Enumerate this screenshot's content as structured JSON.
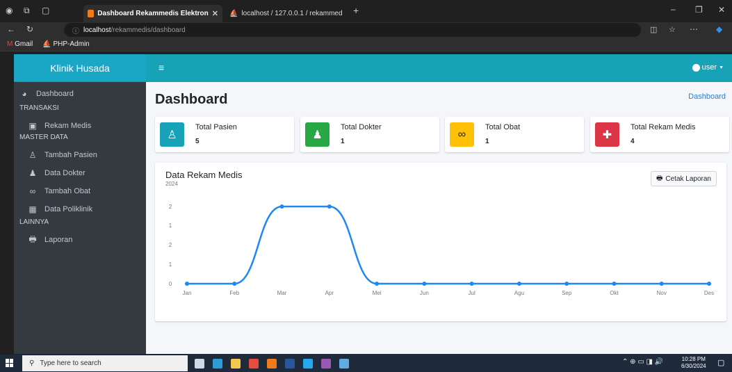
{
  "browser": {
    "tabs": [
      {
        "title": "Dashboard Rekammedis Elektron"
      },
      {
        "title": "localhost / 127.0.0.1 / rekammed"
      }
    ],
    "url_host": "localhost",
    "url_path": "/rekammedis/dashboard",
    "bookmarks": [
      "Gmail",
      "PHP-Admin"
    ]
  },
  "app": {
    "brand": "Klinik Husada",
    "user_label": "user"
  },
  "sidebar": {
    "items": [
      {
        "type": "item",
        "label": "Dashboard",
        "icon": "tachometer-icon"
      },
      {
        "type": "header",
        "label": "TRANSAKSI"
      },
      {
        "type": "item",
        "label": "Rekam Medis",
        "icon": "book-medical-icon"
      },
      {
        "type": "header",
        "label": "MASTER DATA"
      },
      {
        "type": "item",
        "label": "Tambah Pasien",
        "icon": "user-injured-icon"
      },
      {
        "type": "item",
        "label": "Data Dokter",
        "icon": "user-md-icon"
      },
      {
        "type": "item",
        "label": "Tambah Obat",
        "icon": "pills-icon"
      },
      {
        "type": "item",
        "label": "Data Poliklinik",
        "icon": "clinic-icon"
      },
      {
        "type": "header",
        "label": "LAINNYA"
      },
      {
        "type": "item",
        "label": "Laporan",
        "icon": "print-icon"
      }
    ]
  },
  "page": {
    "title": "Dashboard",
    "breadcrumb": "Dashboard"
  },
  "stats": [
    {
      "label": "Total Pasien",
      "value": "5",
      "color": "#17a2b8",
      "icon": "user-injured-icon"
    },
    {
      "label": "Total Dokter",
      "value": "1",
      "color": "#28a745",
      "icon": "user-md-icon"
    },
    {
      "label": "Total Obat",
      "value": "1",
      "color": "#ffc107",
      "icon": "pills-icon"
    },
    {
      "label": "Total Rekam Medis",
      "value": "4",
      "color": "#dc3545",
      "icon": "notes-medical-icon"
    }
  ],
  "chart_card": {
    "title": "Data Rekam Medis",
    "subtitle": "2024",
    "button_label": "Cetak Laporan"
  },
  "chart_data": {
    "type": "line",
    "categories": [
      "Jan",
      "Feb",
      "Mar",
      "Apr",
      "Mei",
      "Jun",
      "Jul",
      "Agu",
      "Sep",
      "Okt",
      "Nov",
      "Des"
    ],
    "values": [
      0,
      0,
      2,
      2,
      0,
      0,
      0,
      0,
      0,
      0,
      0,
      0
    ],
    "ylim": [
      0,
      2
    ],
    "yticks": [
      "0",
      "1",
      "2",
      "1",
      "2"
    ],
    "line_color": "#1e88f0",
    "grid": false
  },
  "taskbar": {
    "search_placeholder": "Type here to search",
    "time": "10:28 PM",
    "date": "6/30/2024"
  }
}
